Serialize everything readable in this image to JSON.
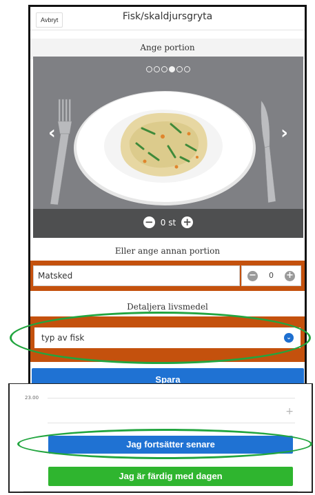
{
  "header": {
    "cancel_label": "Avbryt",
    "title": "Fisk/skaldjursgryta"
  },
  "portion": {
    "heading": "Ange portion",
    "carousel_total": 6,
    "carousel_active_index": 3,
    "count_value": "0",
    "count_unit": "st"
  },
  "other_portion": {
    "heading": "Eller ange annan portion",
    "measure_value": "Matsked",
    "quantity_value": "0"
  },
  "detail": {
    "heading": "Detaljera livsmedel",
    "select_value": "typ av fisk"
  },
  "actions": {
    "save_label": "Spara",
    "continue_label": "Jag fortsätter senare",
    "done_label": "Jag är färdig med dagen"
  },
  "timeline": {
    "time_label": "23.00"
  },
  "icons": {
    "carousel_prev": "chevron-left-icon",
    "carousel_next": "chevron-right-icon",
    "decrement": "minus-circle-icon",
    "increment": "plus-circle-icon",
    "select_dropdown": "chevron-down-circle-icon",
    "add": "plus-icon"
  },
  "colors": {
    "primary_blue": "#1f72d3",
    "done_green": "#2fb52f",
    "highlight_orange": "#c4510d",
    "annotation_green": "#22a53f"
  }
}
